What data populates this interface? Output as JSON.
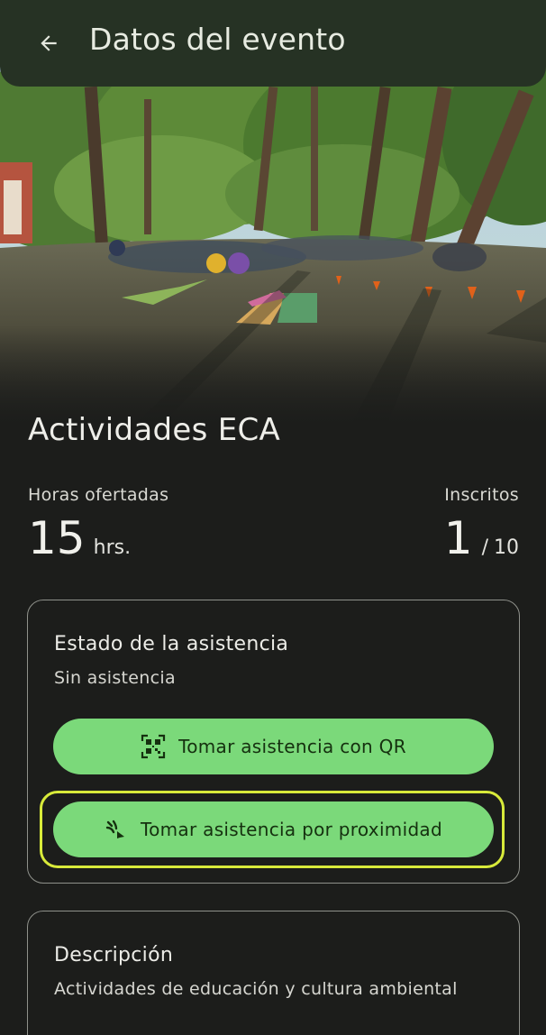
{
  "appbar": {
    "title": "Datos del evento",
    "back_icon": "arrow-left-icon"
  },
  "hero": {
    "image": "photo-of-outdoor-event-in-park"
  },
  "event": {
    "title": "Actividades ECA",
    "hours_label": "Horas ofertadas",
    "hours_value": "15",
    "hours_unit": "hrs.",
    "enrolled_label": "Inscritos",
    "enrolled_value": "1",
    "enrolled_sep": "/",
    "enrolled_max": "10"
  },
  "attendance": {
    "heading": "Estado de la asistencia",
    "status": "Sin asistencia",
    "qr_button": "Tomar asistencia con QR",
    "qr_icon": "qr-code-icon",
    "proximity_button": "Tomar asistencia por proximidad",
    "proximity_icon": "nearby-signal-icon"
  },
  "description": {
    "heading": "Descripción",
    "text": "Actividades de educación y cultura ambiental"
  },
  "colors": {
    "appbar": "#263224",
    "background": "#1c1d1b",
    "button": "#7bd97a",
    "button_text": "#15300f",
    "focus_ring": "#d8ea3a"
  }
}
